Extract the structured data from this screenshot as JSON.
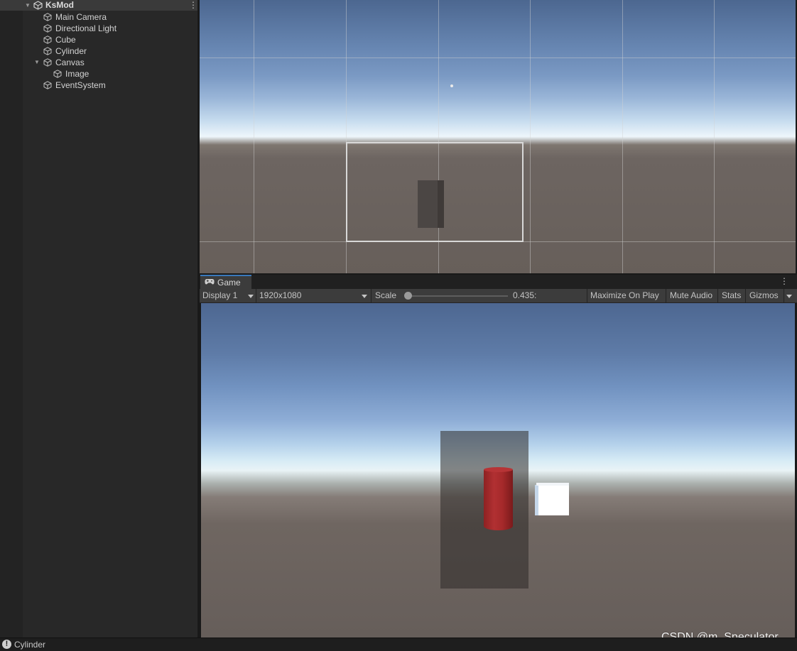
{
  "hierarchy": {
    "scene_name": "KsMod",
    "items": [
      {
        "label": "Main Camera"
      },
      {
        "label": "Directional Light"
      },
      {
        "label": "Cube"
      },
      {
        "label": "Cylinder"
      },
      {
        "label": "Canvas"
      },
      {
        "label": "Image"
      },
      {
        "label": "EventSystem"
      }
    ]
  },
  "game": {
    "tab_label": "Game",
    "display_label": "Display 1",
    "resolution_label": "1920x1080",
    "scale_label": "Scale",
    "scale_value": "0.435:",
    "scale_fraction": 0.02,
    "maximize_label": "Maximize On Play",
    "mute_label": "Mute Audio",
    "stats_label": "Stats",
    "gizmos_label": "Gizmos"
  },
  "watermark": "CSDN @m_Speculator",
  "status": {
    "icon": "info-icon",
    "icon_glyph": "!",
    "text": "Cylinder"
  },
  "colors": {
    "accent": "#3a79bb",
    "cylinder": "#a5292a",
    "cube": "#ffffff"
  }
}
